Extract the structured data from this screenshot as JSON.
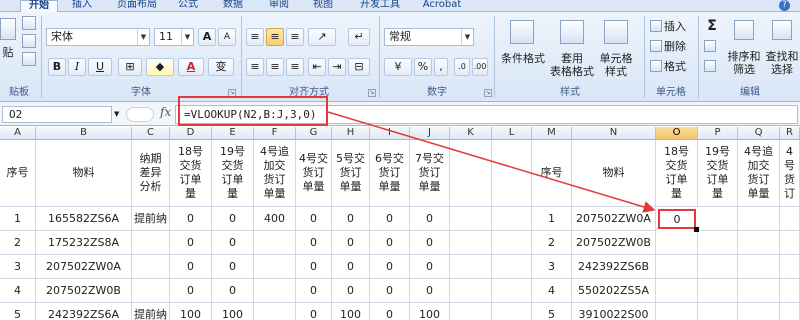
{
  "tabs": [
    "开始",
    "插入",
    "页面布局",
    "公式",
    "数据",
    "审阅",
    "视图",
    "开发工具",
    "Acrobat"
  ],
  "ribbon": {
    "clipboard": {
      "paste": "贴",
      "group_label": "贴板"
    },
    "font": {
      "font_name": "宋体",
      "font_size": "11",
      "bold": "B",
      "italic": "I",
      "underline": "U",
      "grow": "A",
      "shrink": "A",
      "font_color": "A",
      "wen": "变",
      "group_label": "字体"
    },
    "alignment": {
      "group_label": "对齐方式"
    },
    "number": {
      "format": "常规",
      "percent": "%",
      "comma": ",",
      "group_label": "数字"
    },
    "styles": {
      "cond_format": "条件格式",
      "table_format": "套用\n表格格式",
      "cell_styles": "单元格\n样式",
      "group_label": "样式"
    },
    "cells": {
      "insert": "插入",
      "delete": "删除",
      "format": "格式",
      "group_label": "单元格"
    },
    "editing": {
      "sigma": "Σ",
      "sort": "排序和\n筛选",
      "find": "查找和\n选择",
      "group_label": "编辑"
    }
  },
  "formula_bar": {
    "name_box": "O2",
    "fx": "fx",
    "formula": "=VLOOKUP(N2,B:J,3,0)"
  },
  "columns": [
    "A",
    "B",
    "C",
    "D",
    "E",
    "F",
    "G",
    "H",
    "I",
    "J",
    "K",
    "L",
    "M",
    "N",
    "O",
    "P",
    "Q",
    "R"
  ],
  "selected_column": "O",
  "left_table": {
    "headers": [
      "序号",
      "物料",
      "纳期\n差异\n分析",
      "18号\n交货\n订单\n量",
      "19号\n交货\n订单\n量",
      "4号追\n加交\n货订\n单量",
      "4号交\n货订\n单量",
      "5号交\n货订\n单量",
      "6号交\n货订\n单量",
      "7号交\n货订\n单量"
    ],
    "rows": [
      [
        "1",
        "165582ZS6A",
        "提前纳",
        "0",
        "0",
        "400",
        "0",
        "0",
        "0",
        "0"
      ],
      [
        "2",
        "175232ZS8A",
        "",
        "0",
        "0",
        "",
        "0",
        "0",
        "0",
        "0"
      ],
      [
        "3",
        "207502ZW0A",
        "",
        "0",
        "0",
        "",
        "0",
        "0",
        "0",
        "0"
      ],
      [
        "4",
        "207502ZW0B",
        "",
        "0",
        "0",
        "",
        "0",
        "0",
        "0",
        "0"
      ],
      [
        "5",
        "242392ZS6A",
        "提前纳",
        "100",
        "100",
        "",
        "0",
        "100",
        "0",
        "100"
      ]
    ]
  },
  "right_table": {
    "headers": [
      "序号",
      "物料",
      "18号\n交货\n订单\n量",
      "19号\n交货\n订单\n量",
      "4号追\n加交\n货订\n单量",
      "4号\n货订"
    ],
    "rows": [
      [
        "1",
        "207502ZW0A",
        "0",
        "",
        "",
        ""
      ],
      [
        "2",
        "207502ZW0B",
        "",
        "",
        "",
        ""
      ],
      [
        "3",
        "242392ZS6B",
        "",
        "",
        "",
        ""
      ],
      [
        "4",
        "550202ZS5A",
        "",
        "",
        "",
        ""
      ],
      [
        "5",
        "3910022S00",
        "",
        "",
        "",
        ""
      ]
    ]
  },
  "colors": {
    "highlight_red": "#e23a3a",
    "selected_header": "#f2c46c"
  }
}
